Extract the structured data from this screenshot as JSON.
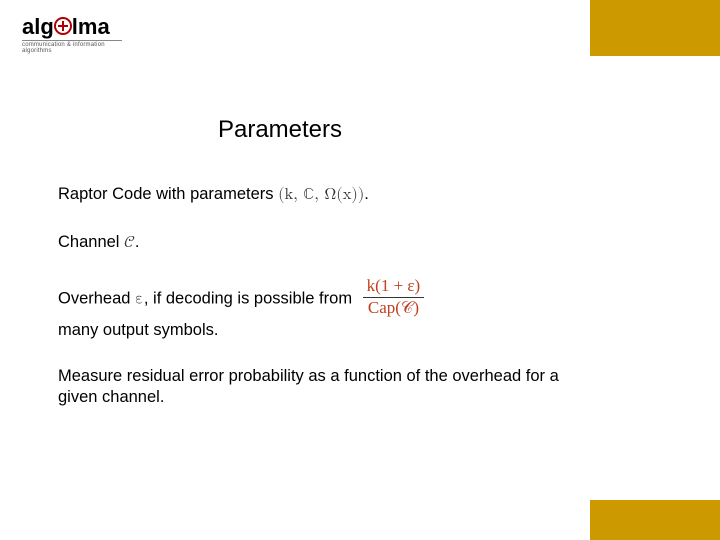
{
  "logo": {
    "text_left": "alg",
    "text_right": "lma",
    "subtitle": "communication & information algorithms"
  },
  "title": "Parameters",
  "body": {
    "p1_prefix": "Raptor Code with parameters ",
    "p1_math": "(k, ℂ, Ω(x))",
    "p1_suffix": ".",
    "p2_prefix": "Channel ",
    "p2_math": "𝒞",
    "p2_suffix": ".",
    "p3_prefix": "Overhead ",
    "p3_math_eps": "ε",
    "p3_mid": ", if decoding is possible from ",
    "p3_frac_num": "k(1 + ε)",
    "p3_frac_den": "Cap(𝒞)",
    "p3_line2": "many output symbols.",
    "p4": "Measure residual error probability as a function of the overhead for a given channel."
  }
}
